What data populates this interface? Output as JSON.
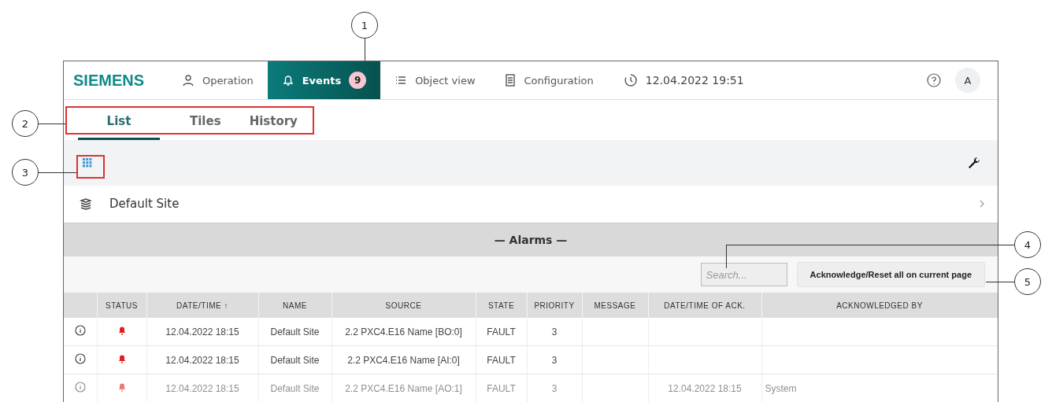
{
  "nav": {
    "logo": "SIEMENS",
    "items": [
      {
        "label": "Operation",
        "kind": "operation",
        "selected": false
      },
      {
        "label": "Events",
        "kind": "events",
        "selected": true,
        "badge": "9"
      },
      {
        "label": "Object view",
        "kind": "objects",
        "selected": false
      },
      {
        "label": "Configuration",
        "kind": "config",
        "selected": false
      }
    ],
    "datetime": "12.04.2022 19:51",
    "avatar": "A"
  },
  "tabs": [
    {
      "label": "List",
      "selected": true
    },
    {
      "label": "Tiles",
      "selected": false
    },
    {
      "label": "History",
      "selected": false
    }
  ],
  "site": {
    "name": "Default Site"
  },
  "section_title": "— Alarms —",
  "search": {
    "placeholder": "Search..."
  },
  "ack_button": "Acknowledge/Reset all on current page",
  "table": {
    "columns": [
      "",
      "STATUS",
      "DATE/TIME ↑",
      "NAME",
      "SOURCE",
      "STATE",
      "PRIORITY",
      "MESSAGE",
      "DATE/TIME OF ACK.",
      "ACKNOWLEDGED BY"
    ],
    "rows": [
      {
        "faded": false,
        "datetime": "12.04.2022 18:15",
        "name": "Default Site",
        "source": "2.2 PXC4.E16 Name [BO:0]",
        "state": "FAULT",
        "priority": "3",
        "ack_time": "",
        "ack_by": ""
      },
      {
        "faded": false,
        "datetime": "12.04.2022 18:15",
        "name": "Default Site",
        "source": "2.2 PXC4.E16 Name [AI:0]",
        "state": "FAULT",
        "priority": "3",
        "ack_time": "",
        "ack_by": ""
      },
      {
        "faded": true,
        "datetime": "12.04.2022 18:15",
        "name": "Default Site",
        "source": "2.2 PXC4.E16 Name [AO:1]",
        "state": "FAULT",
        "priority": "3",
        "ack_time": "12.04.2022 18:15",
        "ack_by": "System"
      }
    ]
  },
  "callouts": [
    {
      "label": "1"
    },
    {
      "label": "2"
    },
    {
      "label": "3"
    },
    {
      "label": "4"
    },
    {
      "label": "5"
    }
  ]
}
